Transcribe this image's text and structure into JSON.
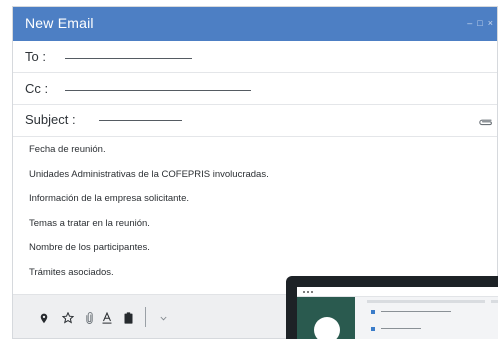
{
  "window": {
    "title": "New Email"
  },
  "window_controls": {
    "minimize": "–",
    "maximize": "□",
    "close": "×"
  },
  "fields": {
    "to_label": "To :",
    "cc_label": "Cc :",
    "subject_label": "Subject :"
  },
  "body_lines": [
    "Fecha de reunión.",
    "Unidades Administrativas de la COFEPRIS involucradas.",
    "Información de la empresa solicitante.",
    "Temas a tratar en la reunión.",
    "Nombre de los participantes.",
    "Trámites asociados."
  ],
  "toolbar": {
    "icons": [
      "location-pin-icon",
      "star-icon",
      "paperclip-icon",
      "text-format-icon",
      "clipboard-icon",
      "chevron-down-icon"
    ]
  },
  "colors": {
    "title_bar": "#4d7fc4",
    "toolbar_bg": "#eeeff1",
    "laptop_accent": "#2a5a4f",
    "laptop_list_bullet": "#3b7cc9"
  }
}
